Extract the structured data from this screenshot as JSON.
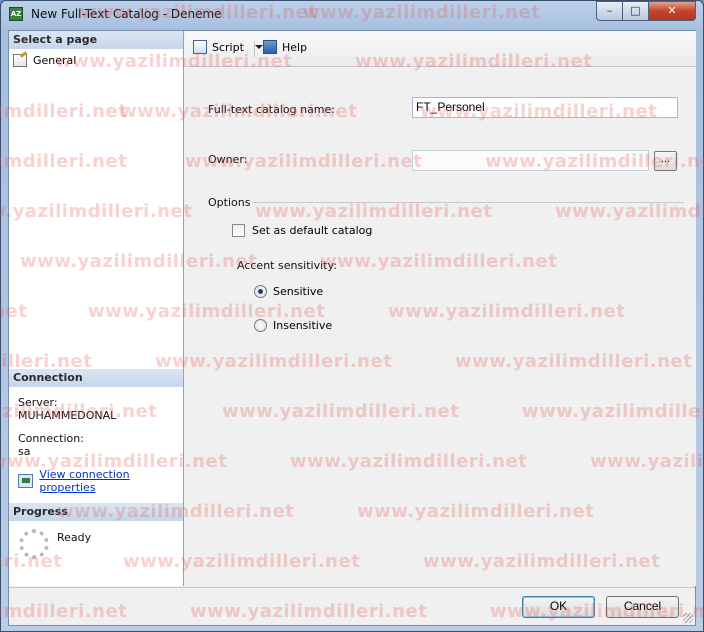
{
  "window": {
    "title": "New Full-Text Catalog - Deneme",
    "app_icon_text": "AZ",
    "controls": {
      "minimize": "–",
      "maximize": "□",
      "close": "✕"
    }
  },
  "left_pane": {
    "select_page_header": "Select a page",
    "pages": [
      {
        "label": "General",
        "icon": "page-properties-icon"
      }
    ],
    "connection_header": "Connection",
    "server_label": "Server:",
    "server_value": "MUHAMMEDONAL",
    "connection_label": "Connection:",
    "connection_value": "sa",
    "view_connection_link": "View connection properties",
    "progress_header": "Progress",
    "progress_status": "Ready"
  },
  "toolbar": {
    "script_label": "Script",
    "help_label": "Help"
  },
  "form": {
    "catalog_name_label": "Full-text catalog name:",
    "catalog_name_value": "FT_Personel",
    "owner_label": "Owner:",
    "owner_value": "",
    "browse_label": "...",
    "options_label": "Options",
    "default_catalog_label": "Set as default catalog",
    "default_catalog_checked": false,
    "accent_label": "Accent sensitivity:",
    "sensitive_label": "Sensitive",
    "insensitive_label": "Insensitive",
    "accent_selected": "Sensitive"
  },
  "buttons": {
    "ok_label": "OK",
    "cancel_label": "Cancel"
  },
  "watermark": {
    "text": "www.yazilimdilleri.net",
    "color": "#e65a5a"
  }
}
